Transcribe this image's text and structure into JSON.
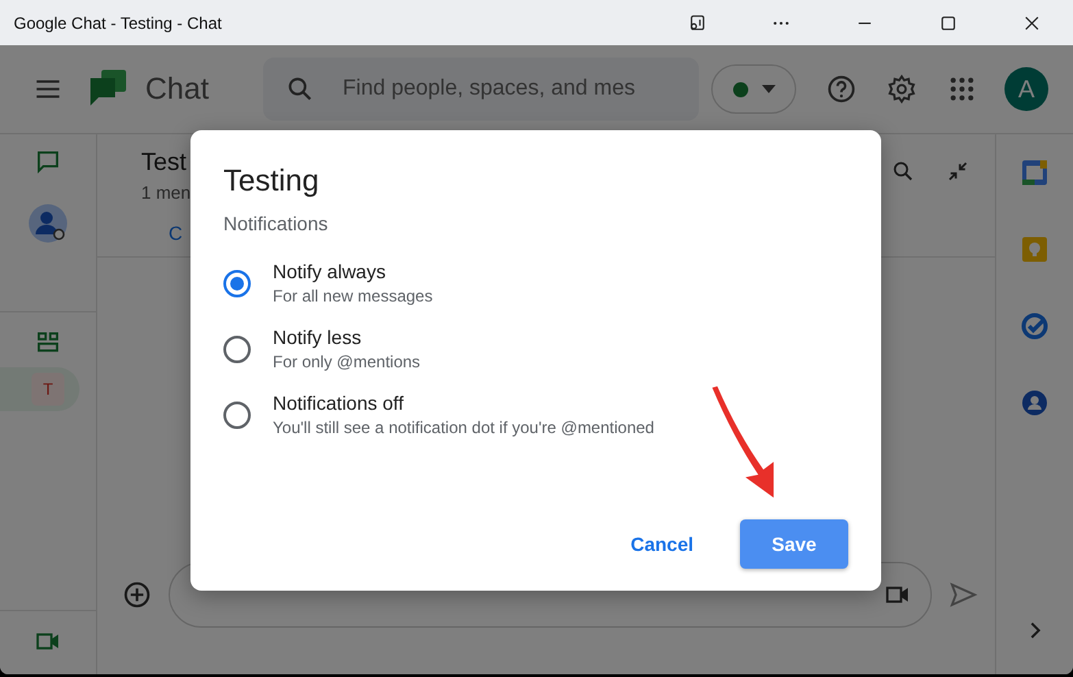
{
  "window": {
    "title": "Google Chat - Testing - Chat"
  },
  "app_bar": {
    "logo_text": "Chat",
    "search": {
      "placeholder": "Find people, spaces, and mes"
    },
    "avatar": "A"
  },
  "spaces": [
    {
      "initial": "T",
      "selected": true
    }
  ],
  "conversation": {
    "title": "Test",
    "subtitle": "1 men",
    "tabs": [
      {
        "label": "C",
        "selected": true
      }
    ]
  },
  "dialog": {
    "title": "Testing",
    "section": "Notifications",
    "options": [
      {
        "label": "Notify always",
        "description": "For all new messages",
        "selected": true
      },
      {
        "label": "Notify less",
        "description": "For only @mentions",
        "selected": false
      },
      {
        "label": "Notifications off",
        "description": "You'll still see a notification dot if you're @mentioned",
        "selected": false
      }
    ],
    "buttons": [
      {
        "label": "Cancel",
        "kind": "text"
      },
      {
        "label": "Save",
        "kind": "primary"
      }
    ]
  }
}
